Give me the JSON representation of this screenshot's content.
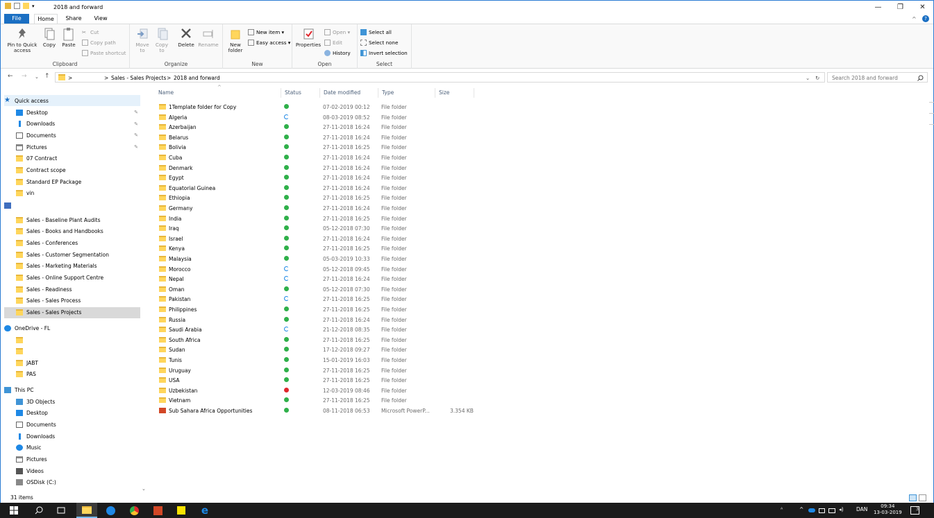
{
  "window": {
    "title": "2018 and forward",
    "minimize": "—",
    "maximize": "❐",
    "close": "✕",
    "help": "?",
    "collapse": "^"
  },
  "tabs": [
    "File",
    "Home",
    "Share",
    "View"
  ],
  "ribbon": {
    "clipboard": {
      "label": "Clipboard",
      "pin": "Pin to Quick access",
      "copy": "Copy",
      "paste": "Paste",
      "cut": "Cut",
      "copy_path": "Copy path",
      "paste_shortcut": "Paste shortcut"
    },
    "organize": {
      "label": "Organize",
      "move": "Move to",
      "copy": "Copy to",
      "delete": "Delete",
      "rename": "Rename"
    },
    "new": {
      "label": "New",
      "new_folder": "New folder",
      "new_item": "New item ▾",
      "easy_access": "Easy access ▾"
    },
    "open": {
      "label": "Open",
      "properties": "Properties",
      "open": "Open ▾",
      "edit": "Edit",
      "history": "History"
    },
    "select": {
      "label": "Select",
      "select_all": "Select all",
      "select_none": "Select none",
      "invert": "Invert selection"
    }
  },
  "address": {
    "crumb1": "Sales - Sales Projects",
    "crumb2": "2018 and forward",
    "sep": ">"
  },
  "search": {
    "placeholder": "Search 2018 and forward"
  },
  "nav": {
    "quick_access": "Quick access",
    "quick": [
      {
        "label": "Desktop",
        "icon": "desktop-icon",
        "pinned": true
      },
      {
        "label": "Downloads",
        "icon": "download-icon",
        "pinned": true
      },
      {
        "label": "Documents",
        "icon": "documents-icon",
        "pinned": true
      },
      {
        "label": "Pictures",
        "icon": "pictures-icon",
        "pinned": true
      },
      {
        "label": "07 Contract",
        "icon": "folder-icon"
      },
      {
        "label": "Contract scope",
        "icon": "folder-icon"
      },
      {
        "label": "Standard EP Package",
        "icon": "folder-icon"
      },
      {
        "label": "vin",
        "icon": "folder-icon"
      }
    ],
    "sharepoint": [
      "Sales - Baseline Plant Audits",
      "Sales - Books and Handbooks",
      "Sales - Conferences",
      "Sales - Customer Segmentation",
      "Sales - Marketing Materials",
      "Sales - Online Support Centre",
      "Sales - Readiness",
      "Sales - Sales Process",
      "Sales - Sales Projects"
    ],
    "onedrive": "OneDrive - FL",
    "onedrive_items": [
      "JABT",
      "PAS"
    ],
    "this_pc": "This PC",
    "pc_items": [
      {
        "label": "3D Objects",
        "icon": "3d-objects-icon"
      },
      {
        "label": "Desktop",
        "icon": "desktop-icon"
      },
      {
        "label": "Documents",
        "icon": "documents-icon"
      },
      {
        "label": "Downloads",
        "icon": "download-icon"
      },
      {
        "label": "Music",
        "icon": "music-icon"
      },
      {
        "label": "Pictures",
        "icon": "pictures-icon"
      },
      {
        "label": "Videos",
        "icon": "videos-icon"
      },
      {
        "label": "OSDisk (C:)",
        "icon": "disk-icon"
      }
    ]
  },
  "columns": {
    "name": "Name",
    "status": "Status",
    "date": "Date modified",
    "type": "Type",
    "size": "Size"
  },
  "files": [
    {
      "name": "1Template folder for Copy",
      "status": "ok",
      "date": "07-02-2019 00:12",
      "type": "File folder",
      "size": ""
    },
    {
      "name": "Algeria",
      "status": "sync",
      "date": "08-03-2019 08:52",
      "type": "File folder",
      "size": ""
    },
    {
      "name": "Azerbaijan",
      "status": "ok",
      "date": "27-11-2018 16:24",
      "type": "File folder",
      "size": ""
    },
    {
      "name": "Belarus",
      "status": "ok",
      "date": "27-11-2018 16:24",
      "type": "File folder",
      "size": ""
    },
    {
      "name": "Bolivia",
      "status": "ok",
      "date": "27-11-2018 16:25",
      "type": "File folder",
      "size": ""
    },
    {
      "name": "Cuba",
      "status": "ok",
      "date": "27-11-2018 16:24",
      "type": "File folder",
      "size": ""
    },
    {
      "name": "Denmark",
      "status": "ok",
      "date": "27-11-2018 16:24",
      "type": "File folder",
      "size": ""
    },
    {
      "name": "Egypt",
      "status": "ok",
      "date": "27-11-2018 16:24",
      "type": "File folder",
      "size": ""
    },
    {
      "name": "Equatorial Guinea",
      "status": "ok",
      "date": "27-11-2018 16:24",
      "type": "File folder",
      "size": ""
    },
    {
      "name": "Ethiopia",
      "status": "ok",
      "date": "27-11-2018 16:25",
      "type": "File folder",
      "size": ""
    },
    {
      "name": "Germany",
      "status": "ok",
      "date": "27-11-2018 16:24",
      "type": "File folder",
      "size": ""
    },
    {
      "name": "India",
      "status": "ok",
      "date": "27-11-2018 16:25",
      "type": "File folder",
      "size": ""
    },
    {
      "name": "Iraq",
      "status": "ok",
      "date": "05-12-2018 07:30",
      "type": "File folder",
      "size": ""
    },
    {
      "name": "Israel",
      "status": "ok",
      "date": "27-11-2018 16:24",
      "type": "File folder",
      "size": ""
    },
    {
      "name": "Kenya",
      "status": "ok",
      "date": "27-11-2018 16:25",
      "type": "File folder",
      "size": ""
    },
    {
      "name": "Malaysia",
      "status": "ok",
      "date": "05-03-2019 10:33",
      "type": "File folder",
      "size": ""
    },
    {
      "name": "Morocco",
      "status": "sync",
      "date": "05-12-2018 09:45",
      "type": "File folder",
      "size": ""
    },
    {
      "name": "Nepal",
      "status": "sync",
      "date": "27-11-2018 16:24",
      "type": "File folder",
      "size": ""
    },
    {
      "name": "Oman",
      "status": "ok",
      "date": "05-12-2018 07:30",
      "type": "File folder",
      "size": ""
    },
    {
      "name": "Pakistan",
      "status": "sync",
      "date": "27-11-2018 16:25",
      "type": "File folder",
      "size": ""
    },
    {
      "name": "Philippines",
      "status": "ok",
      "date": "27-11-2018 16:25",
      "type": "File folder",
      "size": ""
    },
    {
      "name": "Russia",
      "status": "ok",
      "date": "27-11-2018 16:24",
      "type": "File folder",
      "size": ""
    },
    {
      "name": "Saudi Arabia",
      "status": "sync",
      "date": "21-12-2018 08:35",
      "type": "File folder",
      "size": ""
    },
    {
      "name": "South Africa",
      "status": "ok",
      "date": "27-11-2018 16:25",
      "type": "File folder",
      "size": ""
    },
    {
      "name": "Sudan",
      "status": "ok",
      "date": "17-12-2018 09:27",
      "type": "File folder",
      "size": ""
    },
    {
      "name": "Tunis",
      "status": "ok",
      "date": "15-01-2019 16:03",
      "type": "File folder",
      "size": ""
    },
    {
      "name": "Uruguay",
      "status": "ok",
      "date": "27-11-2018 16:25",
      "type": "File folder",
      "size": ""
    },
    {
      "name": "USA",
      "status": "ok",
      "date": "27-11-2018 16:25",
      "type": "File folder",
      "size": ""
    },
    {
      "name": "Uzbekistan",
      "status": "error",
      "date": "12-03-2019 08:46",
      "type": "File folder",
      "size": ""
    },
    {
      "name": "Vietnam",
      "status": "ok",
      "date": "27-11-2018 16:25",
      "type": "File folder",
      "size": ""
    },
    {
      "name": "Sub Sahara Africa Opportunities",
      "status": "ok",
      "date": "08-11-2018 06:53",
      "type": "Microsoft PowerP...",
      "size": "3.354 KB",
      "icon": "powerpoint-icon"
    }
  ],
  "statusbar": {
    "count": "31 items"
  },
  "taskbar": {
    "time": "09:34",
    "date": "13-03-2019",
    "lang": "DAN",
    "notif": "3"
  },
  "colors": {
    "accent": "#1a6fc3",
    "folder": "#ffd65c",
    "ok": "#2fb04a",
    "sync": "#1e88e5",
    "error": "#e0262c",
    "taskbar": "#1b1b1b"
  }
}
